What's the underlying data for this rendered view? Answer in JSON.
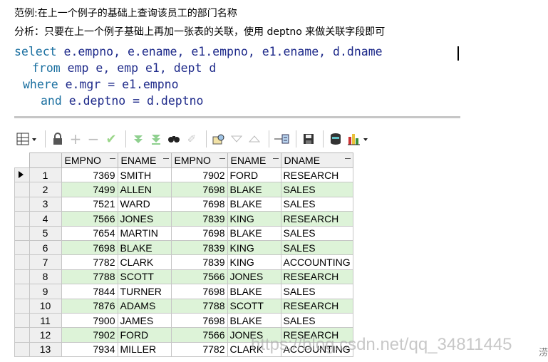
{
  "description": {
    "line1": "范例:在上一个例子的基础上查询该员工的部门名称",
    "line2": "分析：只要在上一个例子基础上再加一张表的关联，使用 deptno 来做关联字段即可"
  },
  "sql": {
    "line1": {
      "kw": "select",
      "rest": " e.empno, e.ename, e1.empno, e1.ename, d.dname"
    },
    "line2": {
      "kw": "from",
      "rest": " emp e, emp e1, dept d"
    },
    "line3": {
      "kw": "where",
      "rest": " e.mgr = e1.empno"
    },
    "line4": {
      "kw": "and",
      "rest": " e.deptno = d.deptno"
    }
  },
  "toolbar": {
    "icons": [
      "grid-view-icon",
      "lock-icon",
      "add-record-icon",
      "delete-record-icon",
      "post-record-icon",
      "fetch-next-icon",
      "fetch-last-icon",
      "find-icon",
      "clear-icon",
      "query-by-example-icon",
      "filter-down-icon",
      "filter-up-icon",
      "export-icon",
      "save-icon",
      "database-icon",
      "chart-icon"
    ]
  },
  "grid": {
    "headers": [
      "EMPNO",
      "ENAME",
      "EMPNO",
      "ENAME",
      "DNAME"
    ],
    "rows": [
      [
        "1",
        "7369",
        "SMITH",
        "7902",
        "FORD",
        "RESEARCH"
      ],
      [
        "2",
        "7499",
        "ALLEN",
        "7698",
        "BLAKE",
        "SALES"
      ],
      [
        "3",
        "7521",
        "WARD",
        "7698",
        "BLAKE",
        "SALES"
      ],
      [
        "4",
        "7566",
        "JONES",
        "7839",
        "KING",
        "RESEARCH"
      ],
      [
        "5",
        "7654",
        "MARTIN",
        "7698",
        "BLAKE",
        "SALES"
      ],
      [
        "6",
        "7698",
        "BLAKE",
        "7839",
        "KING",
        "SALES"
      ],
      [
        "7",
        "7782",
        "CLARK",
        "7839",
        "KING",
        "ACCOUNTING"
      ],
      [
        "8",
        "7788",
        "SCOTT",
        "7566",
        "JONES",
        "RESEARCH"
      ],
      [
        "9",
        "7844",
        "TURNER",
        "7698",
        "BLAKE",
        "SALES"
      ],
      [
        "10",
        "7876",
        "ADAMS",
        "7788",
        "SCOTT",
        "RESEARCH"
      ],
      [
        "11",
        "7900",
        "JAMES",
        "7698",
        "BLAKE",
        "SALES"
      ],
      [
        "12",
        "7902",
        "FORD",
        "7566",
        "JONES",
        "RESEARCH"
      ],
      [
        "13",
        "7934",
        "MILLER",
        "7782",
        "CLARK",
        "ACCOUNTING"
      ]
    ]
  },
  "watermark": "https://blog.csdn.net/qq_34811445",
  "corner_char": "涝"
}
